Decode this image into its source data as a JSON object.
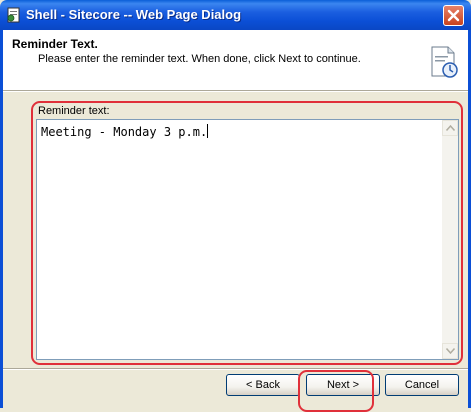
{
  "window": {
    "title": "Shell - Sitecore -- Web Page Dialog"
  },
  "header": {
    "title": "Reminder Text.",
    "subtitle": "Please enter the reminder text. When done, click Next to continue."
  },
  "form": {
    "label": "Reminder text:",
    "value": "Meeting - Monday 3 p.m."
  },
  "buttons": {
    "back": "< Back",
    "next": "Next >",
    "cancel": "Cancel"
  },
  "icons": {
    "title": "sitecore-page-icon",
    "close": "close-icon",
    "header": "calendar-document-icon",
    "scroll_up": "scroll-up-arrow-icon",
    "scroll_down": "scroll-down-arrow-icon"
  },
  "colors": {
    "titlebar": "#0b4fd6",
    "highlight": "#e0303a",
    "dialog_bg": "#ece9d8"
  }
}
